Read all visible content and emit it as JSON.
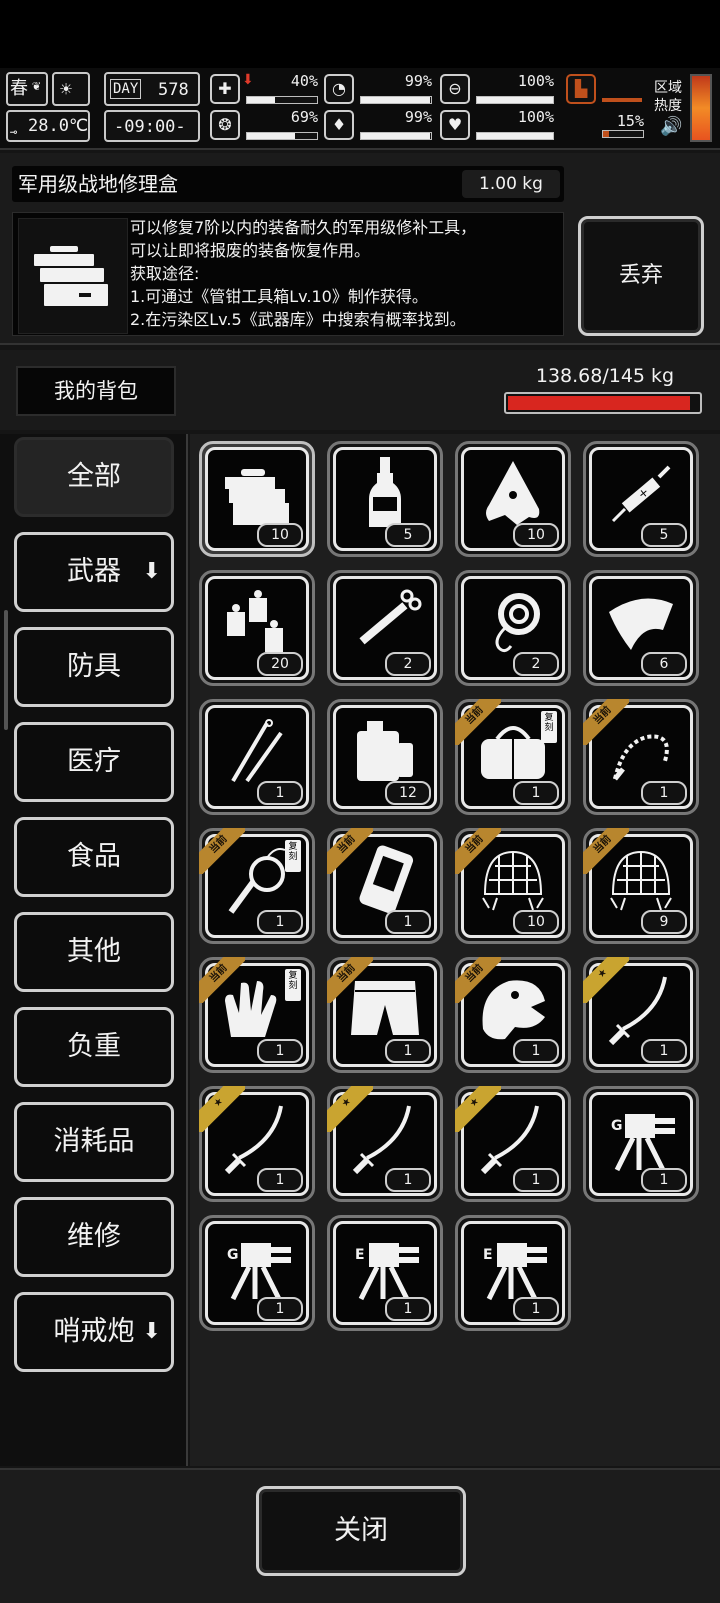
{
  "hud": {
    "season": "春",
    "temperature": "28.0℃",
    "day_label": "DAY",
    "day_value": "578",
    "time": "-09:00-",
    "stats": [
      {
        "name": "health",
        "pct": "40%",
        "value": 40
      },
      {
        "name": "hunger",
        "pct": "99%",
        "value": 99
      },
      {
        "name": "energy",
        "pct": "100%",
        "value": 100
      },
      {
        "name": "stamina",
        "pct": "69%",
        "value": 69
      },
      {
        "name": "thirst",
        "pct": "99%",
        "value": 99
      },
      {
        "name": "mood",
        "pct": "100%",
        "value": 100
      }
    ],
    "boot_pct": "15%",
    "boot_value": 15,
    "area_heat_label_1": "区域",
    "area_heat_label_2": "热度"
  },
  "detail": {
    "item_name": "军用级战地修理盒",
    "weight": "1.00 kg",
    "description": "可以修复7阶以内的装备耐久的军用级修补工具，\n可以让即将报废的装备恢复作用。\n获取途径:\n1.可通过《管钳工具箱Lv.10》制作获得。\n2.在污染区Lv.5《武器库》中搜索有概率找到。",
    "discard_label": "丢弃"
  },
  "backpack": {
    "title": "我的背包",
    "capacity_text": "138.68/145 kg",
    "capacity_fraction": 0.956
  },
  "categories": [
    {
      "label": "全部",
      "active": true
    },
    {
      "label": "武器",
      "arrow": true
    },
    {
      "label": "防具"
    },
    {
      "label": "医疗"
    },
    {
      "label": "食品"
    },
    {
      "label": "其他"
    },
    {
      "label": "负重"
    },
    {
      "label": "消耗品"
    },
    {
      "label": "维修"
    },
    {
      "label": "哨戒炮",
      "arrow": true
    }
  ],
  "ribbon_text": "当前",
  "copy_tag": "复刻",
  "items": [
    {
      "icon": "toolbox-icon",
      "count": "10",
      "selected": true
    },
    {
      "icon": "bottle-icon",
      "count": "5"
    },
    {
      "icon": "cloth-rag-icon",
      "count": "10"
    },
    {
      "icon": "syringe-icon",
      "count": "5"
    },
    {
      "icon": "lanterns-icon",
      "count": "20"
    },
    {
      "icon": "scissors-syringe-icon",
      "count": "2"
    },
    {
      "icon": "rope-hook-icon",
      "count": "2"
    },
    {
      "icon": "fabric-piece-icon",
      "count": "6"
    },
    {
      "icon": "lockpick-icon",
      "count": "1"
    },
    {
      "icon": "fuel-can-icon",
      "count": "12"
    },
    {
      "icon": "duffel-bag-icon",
      "count": "1",
      "ribbon": "current",
      "copy": true
    },
    {
      "icon": "barbed-whip-icon",
      "count": "1",
      "ribbon": "current"
    },
    {
      "icon": "whip-icon",
      "count": "1",
      "ribbon": "current",
      "copy": true
    },
    {
      "icon": "phone-device-icon",
      "count": "1",
      "ribbon": "current"
    },
    {
      "icon": "net-trap-icon",
      "count": "10",
      "ribbon": "current"
    },
    {
      "icon": "net-trap-icon",
      "count": "9",
      "ribbon": "current"
    },
    {
      "icon": "gloves-icon",
      "count": "1",
      "ribbon": "current",
      "copy": true
    },
    {
      "icon": "shorts-icon",
      "count": "1",
      "ribbon": "current"
    },
    {
      "icon": "dino-head-icon",
      "count": "1",
      "ribbon": "current"
    },
    {
      "icon": "katana-icon",
      "count": "1",
      "ribbon": "star"
    },
    {
      "icon": "katana-icon",
      "count": "1",
      "ribbon": "star"
    },
    {
      "icon": "katana-icon",
      "count": "1",
      "ribbon": "star"
    },
    {
      "icon": "katana-icon",
      "count": "1",
      "ribbon": "star"
    },
    {
      "icon": "sentry-turret-g-icon",
      "count": "1"
    },
    {
      "icon": "sentry-turret-g-icon",
      "count": "1"
    },
    {
      "icon": "sentry-turret-e-icon",
      "count": "1"
    },
    {
      "icon": "sentry-turret-e-icon",
      "count": "1"
    }
  ],
  "close_label": "关闭"
}
